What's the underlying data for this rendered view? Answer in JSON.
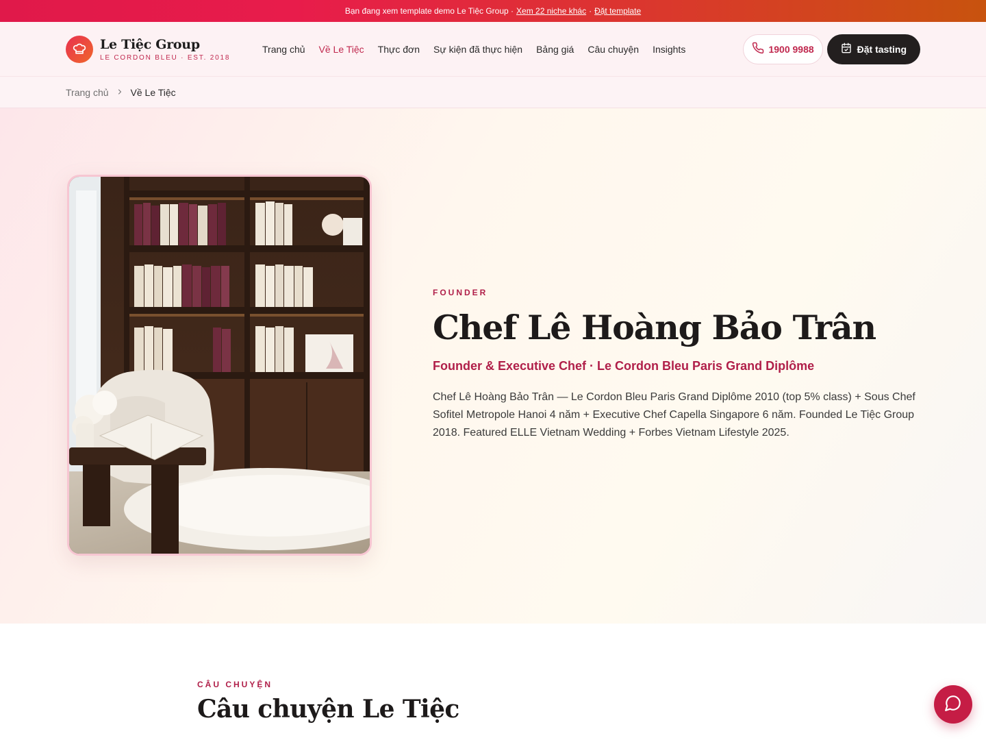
{
  "announcement": {
    "text": "Bạn đang xem template demo Le Tiệc Group ·",
    "link1": "Xem 22 niche khác",
    "sep": "·",
    "link2": "Đặt template"
  },
  "brand": {
    "name": "Le Tiệc Group",
    "tagline": "LE CORDON BLEU · EST. 2018",
    "icon": "chef-hat-icon"
  },
  "nav": {
    "items": [
      {
        "label": "Trang chủ",
        "active": false
      },
      {
        "label": "Về Le Tiệc",
        "active": true
      },
      {
        "label": "Thực đơn",
        "active": false
      },
      {
        "label": "Sự kiện đã thực hiện",
        "active": false
      },
      {
        "label": "Bảng giá",
        "active": false
      },
      {
        "label": "Câu chuyện",
        "active": false
      },
      {
        "label": "Insights",
        "active": false
      }
    ],
    "phone_label": "1900 9988",
    "cta_label": "Đặt tasting"
  },
  "breadcrumb": {
    "home": "Trang chủ",
    "current": "Về Le Tiệc"
  },
  "hero": {
    "eyebrow": "FOUNDER",
    "title": "Chef Lê Hoàng Bảo Trân",
    "role": "Founder & Executive Chef · Le Cordon Bleu Paris Grand Diplôme",
    "bio": "Chef Lê Hoàng Bảo Trân — Le Cordon Bleu Paris Grand Diplôme 2010 (top 5% class) + Sous Chef Sofitel Metropole Hanoi 4 năm + Executive Chef Capella Singapore 6 năm. Founded Le Tiệc Group 2018. Featured ELLE Vietnam Wedding + Forbes Vietnam Lifestyle 2025."
  },
  "story": {
    "eyebrow": "CÂU CHUYỆN",
    "title": "Câu chuyện Le Tiệc"
  },
  "colors": {
    "accent": "#c0284e",
    "dark_button": "#231f1f",
    "fab": "#c51d45"
  },
  "icons": {
    "phone": "phone-icon",
    "calendar": "calendar-icon",
    "chat": "chat-bubble-icon",
    "chevron": "chevron-right-icon"
  }
}
